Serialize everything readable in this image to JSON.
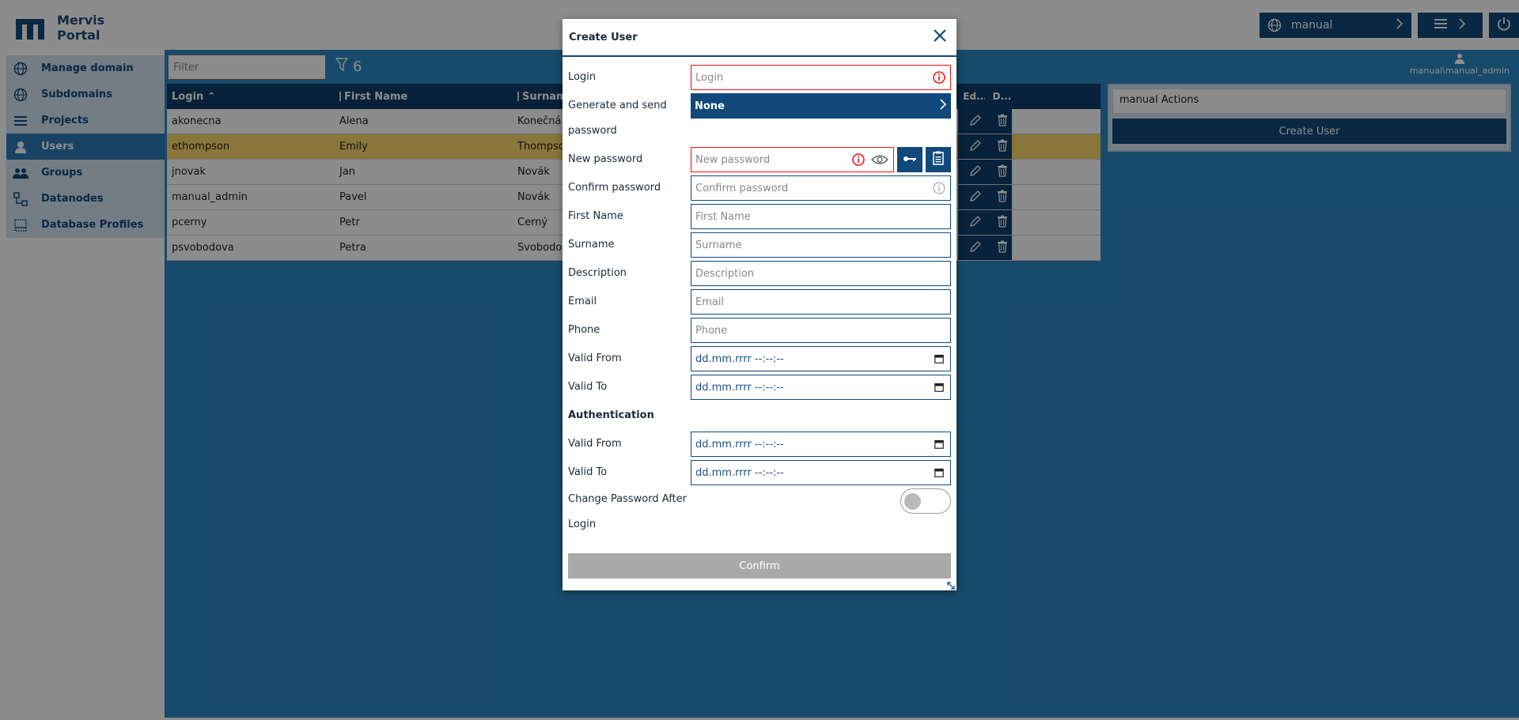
{
  "app": {
    "logo_line1": "Mervis",
    "logo_line2": "Portal",
    "domain": "manual",
    "user": "manual\\manual_admin"
  },
  "sidebar": {
    "items": [
      {
        "label": "Manage domain",
        "icon": "globe-icon"
      },
      {
        "label": "Subdomains",
        "icon": "globe-icon"
      },
      {
        "label": "Projects",
        "icon": "list-icon"
      },
      {
        "label": "Users",
        "icon": "user-icon",
        "active": true
      },
      {
        "label": "Groups",
        "icon": "group-icon"
      },
      {
        "label": "Datanodes",
        "icon": "nodes-icon"
      },
      {
        "label": "Database Profiles",
        "icon": "database-icon"
      }
    ]
  },
  "filter": {
    "placeholder": "Filter",
    "count": "6"
  },
  "grid": {
    "columns": [
      "Login",
      "First Name",
      "Surname",
      "Ed...",
      "D..."
    ],
    "rows": [
      {
        "login": "akonecna",
        "first": "Alena",
        "surname": "Konečná"
      },
      {
        "login": "ethompson",
        "first": "Emily",
        "surname": "Thompson"
      },
      {
        "login": "jnovak",
        "first": "Jan",
        "surname": "Novák"
      },
      {
        "login": "manual_admin",
        "first": "Pavel",
        "surname": "Novák"
      },
      {
        "login": "pcerny",
        "first": "Petr",
        "surname": "Černý"
      },
      {
        "login": "psvobodova",
        "first": "Petra",
        "surname": "Svobodová"
      }
    ]
  },
  "actions": {
    "title": "manual Actions",
    "create_user": "Create User"
  },
  "modal": {
    "title": "Create User",
    "labels": {
      "login": "Login",
      "generate": "Generate and send password",
      "new_password": "New password",
      "confirm_password": "Confirm password",
      "first_name": "First Name",
      "surname": "Surname",
      "description": "Description",
      "email": "Email",
      "phone": "Phone",
      "valid_from": "Valid From",
      "valid_to": "Valid To",
      "authentication": "Authentication",
      "auth_valid_from": "Valid From",
      "auth_valid_to": "Valid To",
      "change_pw_line1": "Change Password After",
      "change_pw_line2": "Login"
    },
    "placeholders": {
      "login": "Login",
      "new_password": "New password",
      "confirm_password": "Confirm password",
      "first_name": "First Name",
      "surname": "Surname",
      "description": "Description",
      "email": "Email",
      "phone": "Phone",
      "date": "dd.mm.rrrr --:--:--"
    },
    "generate_value": "None",
    "confirm": "Confirm",
    "colors": {
      "primary": "#10497a",
      "error": "#e11111",
      "disabled": "#a9a9a9"
    }
  }
}
